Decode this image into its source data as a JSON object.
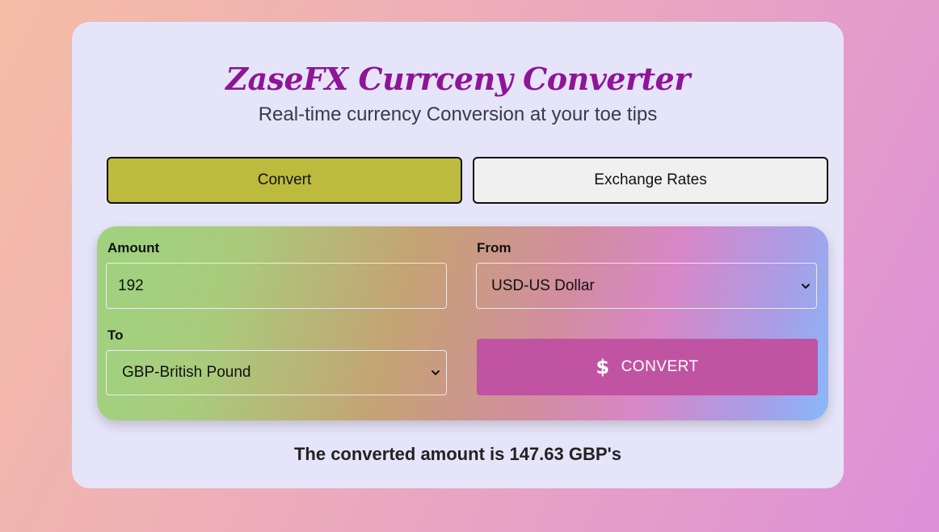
{
  "header": {
    "title": "ZaseFX Currceny Converter",
    "subtitle": "Real-time currency Conversion at your toe tips"
  },
  "tabs": [
    {
      "label": "Convert",
      "active": true
    },
    {
      "label": "Exchange Rates",
      "active": false
    }
  ],
  "form": {
    "amount_label": "Amount",
    "amount_value": "192",
    "from_label": "From",
    "from_value": "USD-US Dollar",
    "to_label": "To",
    "to_value": "GBP-British Pound",
    "convert_icon": "dollar-icon",
    "convert_icon_glyph": "$",
    "convert_label": "CONVERT"
  },
  "result": {
    "text": "The converted amount is 147.63 GBP's"
  },
  "colors": {
    "title": "#8e1597",
    "active_tab": "#bdbb3d",
    "inactive_tab": "#f0f0f0",
    "convert_button": "#c053a2",
    "card": "#e6e4f8"
  }
}
